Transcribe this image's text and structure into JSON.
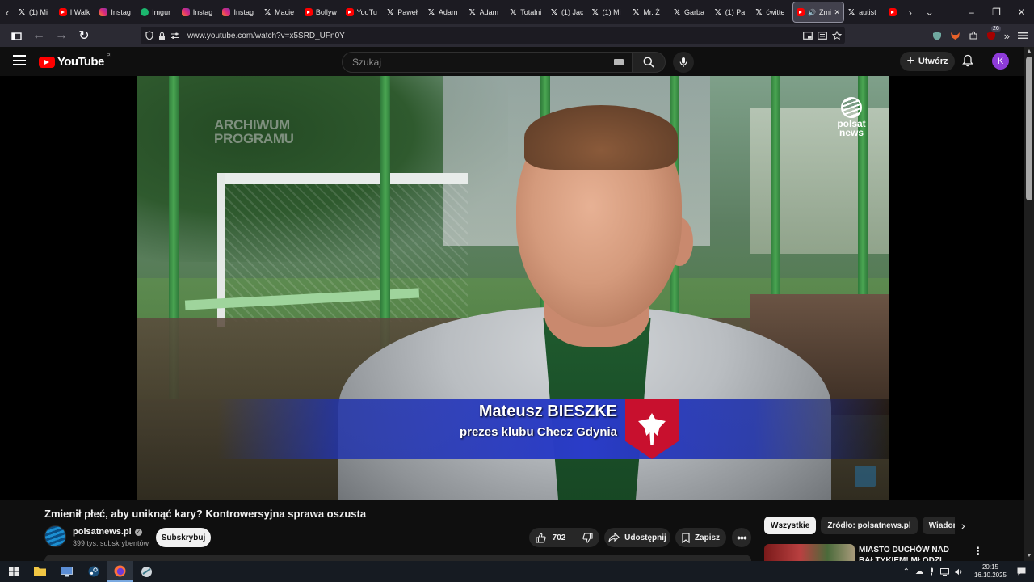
{
  "browser": {
    "tabs": [
      {
        "title": "(1) Mi",
        "icon": "x-icon"
      },
      {
        "title": "I Walk",
        "icon": "youtube-icon"
      },
      {
        "title": "Instag",
        "icon": "instagram-icon"
      },
      {
        "title": "Imgur",
        "icon": "imgur-icon"
      },
      {
        "title": "Instag",
        "icon": "instagram-icon"
      },
      {
        "title": "Instag",
        "icon": "instagram-icon"
      },
      {
        "title": "Macie",
        "icon": "x-icon"
      },
      {
        "title": "Bollyw",
        "icon": "youtube-icon"
      },
      {
        "title": "YouTu",
        "icon": "youtube-icon"
      },
      {
        "title": "Paweł",
        "icon": "x-icon"
      },
      {
        "title": "Adam",
        "icon": "x-icon"
      },
      {
        "title": "Adam",
        "icon": "x-icon"
      },
      {
        "title": "Totalni",
        "icon": "x-icon"
      },
      {
        "title": "(1) Jac",
        "icon": "x-icon"
      },
      {
        "title": "(1) Mi",
        "icon": "x-icon"
      },
      {
        "title": "Mr. Ż",
        "icon": "x-icon"
      },
      {
        "title": "Garba",
        "icon": "x-icon"
      },
      {
        "title": "(1) Pa",
        "icon": "x-icon"
      },
      {
        "title": "ćwitte",
        "icon": "x-icon"
      }
    ],
    "active_tab": {
      "title": "Zmi",
      "icon": "youtube-icon"
    },
    "after_tabs": [
      {
        "title": "autist",
        "icon": "x-icon"
      }
    ],
    "url": "www.youtube.com/watch?v=x5SRD_UFn0Y",
    "extension_badge": "26"
  },
  "youtube": {
    "logo_text": "YouTube",
    "region": "PL",
    "search_placeholder": "Szukaj",
    "create_label": "Utwórz",
    "avatar_letter": "K"
  },
  "video": {
    "overlay_archive": "ARCHIWUM PROGRAMU",
    "overlay_logo_line1": "polsat",
    "overlay_logo_line2": "news",
    "lower_third_name": "Mateusz BIESZKE",
    "lower_third_role": "prezes klubu Checz Gdynia",
    "title": "Zmienił płeć, aby uniknąć kary? Kontrowersyjna sprawa oszusta",
    "channel": "polsatnews.pl",
    "subscribers": "399 tys. subskrybentów",
    "subscribe_label": "Subskrybuj",
    "likes": "702",
    "share_label": "Udostępnij",
    "save_label": "Zapisz"
  },
  "sidebar": {
    "chips": [
      "Wszystkie",
      "Źródło: polsatnews.pl",
      "Wiadomości"
    ],
    "active_chip": 0,
    "recommendation_title": "MIASTO DUCHÓW NAD BAŁTYKIEM! MŁODZI STĄD"
  },
  "taskbar": {
    "time": "20:15",
    "date": "16.10.2025"
  },
  "colors": {
    "brand_red": "#ff0000",
    "background": "#0f0f0f",
    "avatar": "#8e3bd9"
  }
}
